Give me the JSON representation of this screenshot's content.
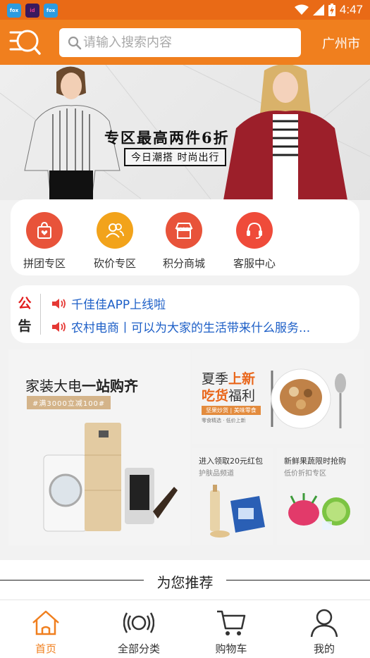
{
  "status_bar": {
    "apps": [
      "fox",
      "id",
      "fox"
    ],
    "time": "4:47"
  },
  "header": {
    "search_placeholder": "请输入搜索内容",
    "city": "广州市"
  },
  "banner": {
    "headline": "专区最高两件6折",
    "subline": "今日潮搭 时尚出行"
  },
  "quick_actions": [
    {
      "label": "拼团专区",
      "icon": "shopping-bag-icon",
      "color": "#e8533a"
    },
    {
      "label": "砍价专区",
      "icon": "users-icon",
      "color": "#f2a31b"
    },
    {
      "label": "积分商城",
      "icon": "store-icon",
      "color": "#e8533a"
    },
    {
      "label": "客服中心",
      "icon": "headset-icon",
      "color": "#ef4b3a"
    }
  ],
  "notice": {
    "tag_top": "公",
    "tag_bottom": "告",
    "items": [
      "千佳佳APP上线啦",
      "农村电商丨可以为大家的生活带来什么服务..."
    ]
  },
  "promos": {
    "appliance": {
      "title_plain": "家装大电",
      "title_bold": "一站购齐",
      "pill": "#满3000立减100#"
    },
    "snacks": {
      "line1_plain": "夏季",
      "line1_hi": "上新",
      "line2_hi": "吃货",
      "line2_plain": "福利",
      "pill": "坚果炒货 | 美味零食",
      "tiny": "零食精选 · 低价上新"
    },
    "redpacket": {
      "title": "进入领取20元红包",
      "sub": "护肤品频道"
    },
    "fresh": {
      "title": "新鲜果蔬限时抢购",
      "sub": "低价折扣专区"
    }
  },
  "recommend": {
    "title": "为您推荐"
  },
  "tabs": [
    {
      "label": "首页",
      "icon": "home-icon",
      "active": true
    },
    {
      "label": "全部分类",
      "icon": "category-icon",
      "active": false
    },
    {
      "label": "购物车",
      "icon": "cart-icon",
      "active": false
    },
    {
      "label": "我的",
      "icon": "user-icon",
      "active": false
    }
  ],
  "colors": {
    "brand": "#f07f1e",
    "active_tab": "#f07f1e",
    "notice_link": "#1d5fc7"
  }
}
